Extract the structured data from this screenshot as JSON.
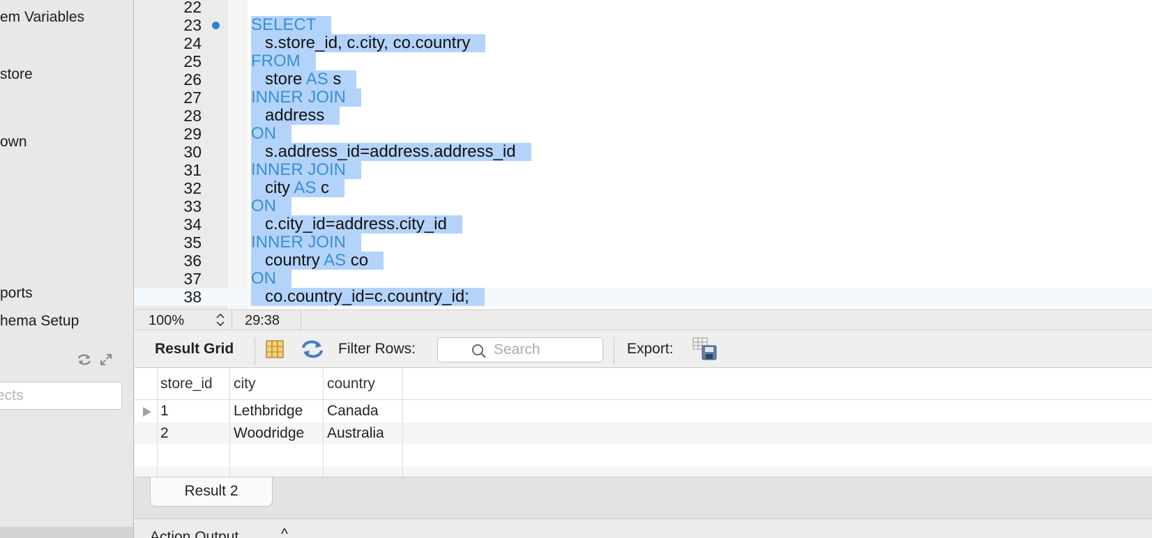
{
  "sidebar": {
    "items": [
      {
        "label": "em Variables"
      },
      {
        "label": "store"
      },
      {
        "label": "own"
      },
      {
        "label": "ports"
      },
      {
        "label": "hema Setup"
      }
    ],
    "filter_placeholder": "ects",
    "icons": [
      "refresh-icon",
      "expand-icon"
    ]
  },
  "editor": {
    "lines": [
      {
        "num": "22",
        "text": ""
      },
      {
        "num": "23",
        "parts": [
          {
            "t": "SELECT",
            "kw": true
          }
        ]
      },
      {
        "num": "24",
        "parts": [
          {
            "t": "   s.store_id, c.city, co.country",
            "kw": false
          }
        ]
      },
      {
        "num": "25",
        "parts": [
          {
            "t": "FROM",
            "kw": true
          }
        ]
      },
      {
        "num": "26",
        "parts": [
          {
            "t": "   store ",
            "kw": false
          },
          {
            "t": "AS",
            "kw": true
          },
          {
            "t": " s",
            "kw": false
          }
        ]
      },
      {
        "num": "27",
        "parts": [
          {
            "t": "INNER JOIN",
            "kw": true
          }
        ]
      },
      {
        "num": "28",
        "parts": [
          {
            "t": "   address",
            "kw": false
          }
        ]
      },
      {
        "num": "29",
        "parts": [
          {
            "t": "ON",
            "kw": true
          }
        ]
      },
      {
        "num": "30",
        "parts": [
          {
            "t": "   s.address_id=address.address_id",
            "kw": false
          }
        ]
      },
      {
        "num": "31",
        "parts": [
          {
            "t": "INNER JOIN",
            "kw": true
          }
        ]
      },
      {
        "num": "32",
        "parts": [
          {
            "t": "   city ",
            "kw": false
          },
          {
            "t": "AS",
            "kw": true
          },
          {
            "t": " c",
            "kw": false
          }
        ]
      },
      {
        "num": "33",
        "parts": [
          {
            "t": "ON",
            "kw": true
          }
        ]
      },
      {
        "num": "34",
        "parts": [
          {
            "t": "   c.city_id=address.city_id",
            "kw": false
          }
        ]
      },
      {
        "num": "35",
        "parts": [
          {
            "t": "INNER JOIN",
            "kw": true
          }
        ]
      },
      {
        "num": "36",
        "parts": [
          {
            "t": "   country ",
            "kw": false
          },
          {
            "t": "AS",
            "kw": true
          },
          {
            "t": " co",
            "kw": false
          }
        ]
      },
      {
        "num": "37",
        "parts": [
          {
            "t": "ON",
            "kw": true
          }
        ]
      },
      {
        "num": "38",
        "parts": [
          {
            "t": "   co.country_id=c.country_id;",
            "kw": false
          }
        ]
      }
    ],
    "zoom": "100%",
    "cursor_position": "29:38"
  },
  "result_toolbar": {
    "result_grid_label": "Result Grid",
    "filter_label": "Filter Rows:",
    "search_placeholder": "Search",
    "export_label": "Export:"
  },
  "grid": {
    "columns": [
      "store_id",
      "city",
      "country"
    ],
    "rows": [
      [
        "1",
        "Lethbridge",
        "Canada"
      ],
      [
        "2",
        "Woodridge",
        "Australia"
      ]
    ]
  },
  "result_tabs": [
    {
      "label": "Result 2"
    }
  ],
  "action_output": {
    "label": "Action Output",
    "caret": "^"
  },
  "colors": {
    "keyword": "#3a8fd1",
    "selection": "#b3d3fb",
    "breakpoint": "#2f7fd8"
  }
}
